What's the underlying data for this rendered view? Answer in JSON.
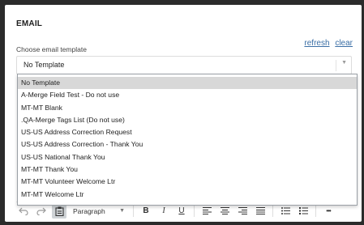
{
  "section": {
    "title": "EMAIL"
  },
  "links": {
    "refresh": "refresh",
    "clear": "clear"
  },
  "template_field": {
    "label": "Choose email template",
    "value": "No Template"
  },
  "dropdown": {
    "options": [
      "No Template",
      "A-Merge Field Test - Do not use",
      "MT-MT Blank",
      ".QA-Merge Tags List (Do not use)",
      "US-US Address Correction Request",
      "US-US Address Correction - Thank You",
      "US-US National Thank You",
      "MT-MT Thank You",
      "MT-MT Volunteer Welcome Ltr",
      "MT-MT Welcome Ltr"
    ],
    "selected_index": 0
  },
  "toolbar": {
    "paragraph_label": "Paragraph",
    "undo_icon": "undo-icon",
    "redo_icon": "redo-icon",
    "paste_icon": "paste-icon",
    "bold_glyph": "B",
    "italic_glyph": "I",
    "underline_glyph": "U",
    "more_glyph": "•••"
  }
}
